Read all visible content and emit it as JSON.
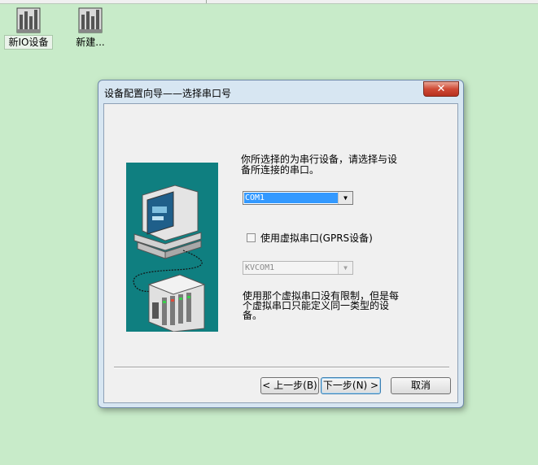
{
  "desktop": {
    "icons": [
      {
        "label": "新IO设备",
        "icon": "io-device-icon"
      },
      {
        "label": "新建...",
        "icon": "io-device-icon"
      }
    ]
  },
  "dialog": {
    "title": "设备配置向导——选择串口号",
    "close_symbol": "✕",
    "intro_text": "你所选择的为串行设备，请选择与设备所连接的串口。",
    "com_port": {
      "value": "COM1"
    },
    "virtual_checkbox": {
      "label": "使用虚拟串口(GPRS设备)",
      "checked": false
    },
    "virtual_port": {
      "value": "KVCOM1",
      "enabled": false
    },
    "note_text": "使用那个虚拟串口没有限制，但是每个虚拟串口只能定义同一类型的设备。",
    "buttons": {
      "back": "< 上一步(B)",
      "next": "下一步(N) >",
      "cancel": "取消"
    }
  },
  "colors": {
    "desktop_bg": "#c8ebc9",
    "illustration_bg": "#0f7f80",
    "selection": "#3399ff",
    "close_button": "#cf4a35"
  }
}
